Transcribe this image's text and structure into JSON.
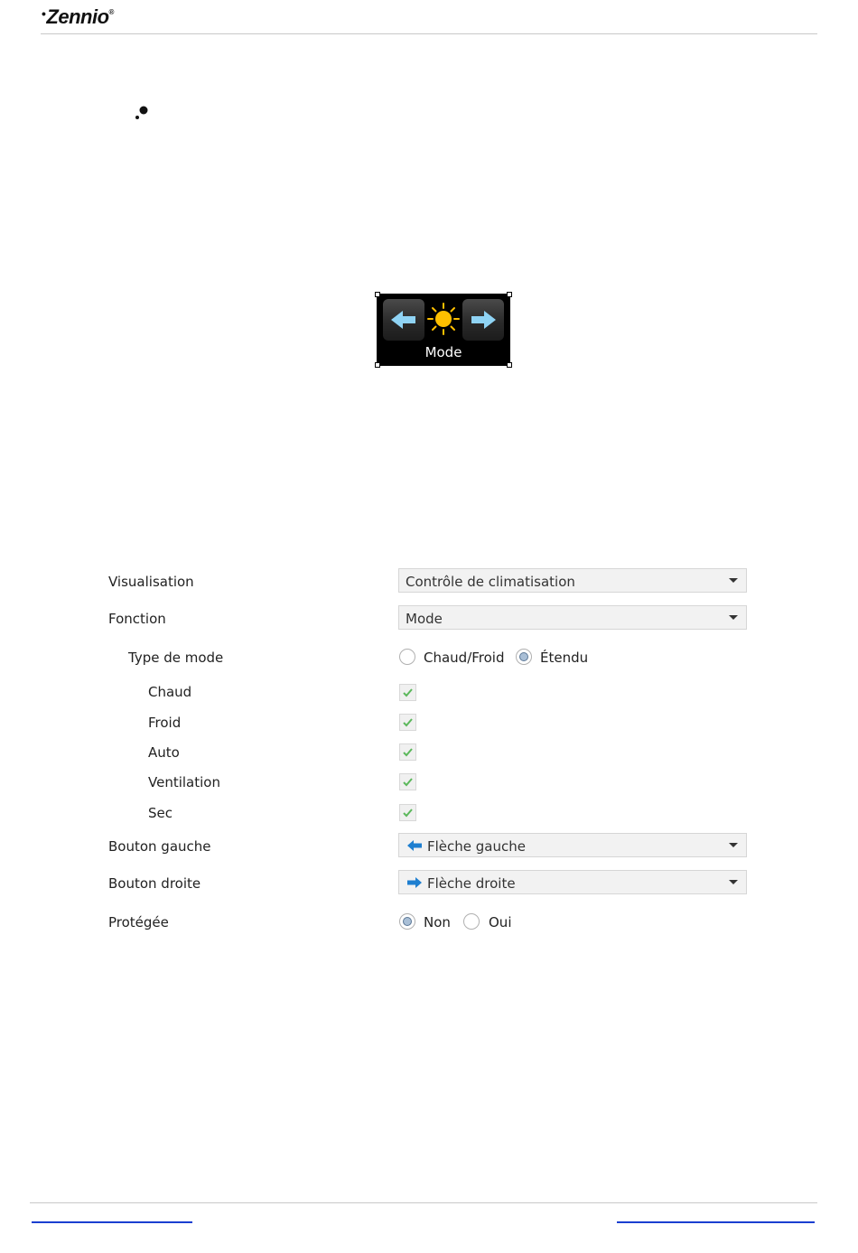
{
  "header": {
    "logo_text": "Zennio",
    "logo_reg": "®"
  },
  "widget": {
    "label": "Mode",
    "left_icon": "left-arrow-icon",
    "center_icon": "sun-icon",
    "right_icon": "right-arrow-icon"
  },
  "params": {
    "visualisation": {
      "label": "Visualisation",
      "value": "Contrôle de climatisation"
    },
    "fonction": {
      "label": "Fonction",
      "value": "Mode"
    },
    "type_de_mode": {
      "label": "Type de mode",
      "options": [
        "Chaud/Froid",
        "Étendu"
      ],
      "selected": "Étendu"
    },
    "modes": [
      {
        "label": "Chaud",
        "checked": true
      },
      {
        "label": "Froid",
        "checked": true
      },
      {
        "label": "Auto",
        "checked": true
      },
      {
        "label": "Ventilation",
        "checked": true
      },
      {
        "label": "Sec",
        "checked": true
      }
    ],
    "bouton_gauche": {
      "label": "Bouton gauche",
      "value": "Flèche gauche",
      "icon": "left-arrow-icon"
    },
    "bouton_droite": {
      "label": "Bouton droite",
      "value": "Flèche droite",
      "icon": "right-arrow-icon"
    },
    "protegee": {
      "label": "Protégée",
      "options": [
        "Non",
        "Oui"
      ],
      "selected": "Non"
    }
  },
  "colors": {
    "arrow_blue": "#8fd3f4",
    "sun_yellow": "#ffc000",
    "check_green": "#5cb85c",
    "link_blue": "#1a3fd0"
  }
}
